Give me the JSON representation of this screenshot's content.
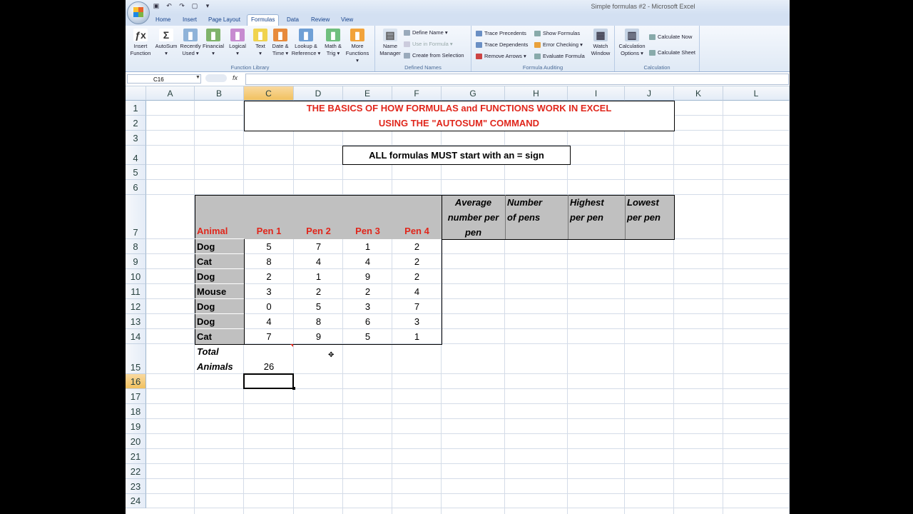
{
  "window": {
    "title": "Simple formulas #2 - Microsoft Excel"
  },
  "tabs": [
    "Home",
    "Insert",
    "Page Layout",
    "Formulas",
    "Data",
    "Review",
    "View"
  ],
  "active_tab": "Formulas",
  "ribbon": {
    "function_library": {
      "label": "Function Library",
      "buttons": [
        {
          "icon": "fx-icon",
          "label1": "Insert",
          "label2": "Function"
        },
        {
          "icon": "sigma-icon",
          "label1": "AutoSum",
          "label2": "▾"
        },
        {
          "icon": "book-icon",
          "label1": "Recently",
          "label2": "Used ▾"
        },
        {
          "icon": "book-icon",
          "label1": "Financial",
          "label2": "▾"
        },
        {
          "icon": "book-icon",
          "label1": "Logical",
          "label2": "▾"
        },
        {
          "icon": "book-icon",
          "label1": "Text",
          "label2": "▾"
        },
        {
          "icon": "book-icon",
          "label1": "Date &",
          "label2": "Time ▾"
        },
        {
          "icon": "book-icon",
          "label1": "Lookup &",
          "label2": "Reference ▾"
        },
        {
          "icon": "book-icon",
          "label1": "Math &",
          "label2": "Trig ▾"
        },
        {
          "icon": "book-icon",
          "label1": "More",
          "label2": "Functions ▾"
        }
      ]
    },
    "defined_names": {
      "label": "Defined Names",
      "name_manager": {
        "label1": "Name",
        "label2": "Manager"
      },
      "define_name": "Define Name ▾",
      "use_in_formula": "Use in Formula ▾",
      "create_from_selection": "Create from Selection"
    },
    "formula_auditing": {
      "label": "Formula Auditing",
      "trace_precedents": "Trace Precedents",
      "trace_dependents": "Trace Dependents",
      "remove_arrows": "Remove Arrows ▾",
      "show_formulas": "Show Formulas",
      "error_checking": "Error Checking ▾",
      "evaluate_formula": "Evaluate Formula",
      "watch_window": {
        "label1": "Watch",
        "label2": "Window"
      }
    },
    "calculation": {
      "label": "Calculation",
      "options": {
        "label1": "Calculation",
        "label2": "Options ▾"
      },
      "calculate_now": "Calculate Now",
      "calculate_sheet": "Calculate Sheet"
    }
  },
  "formula_bar": {
    "name_box": "C16",
    "fx": "fx",
    "formula": ""
  },
  "columns": [
    "A",
    "B",
    "C",
    "D",
    "E",
    "F",
    "G",
    "H",
    "I",
    "J",
    "K",
    "L"
  ],
  "selected_column": "C",
  "rows": [
    "1",
    "2",
    "3",
    "4",
    "5",
    "6",
    "7",
    "8",
    "9",
    "10",
    "11",
    "12",
    "13",
    "14",
    "15",
    "16",
    "17",
    "18",
    "19",
    "20",
    "21",
    "22",
    "23",
    "24"
  ],
  "selected_row": "16",
  "sheet": {
    "title1": "THE BASICS OF HOW FORMULAS and FUNCTIONS WORK IN EXCEL",
    "title2": "USING THE \"AUTOSUM\" COMMAND",
    "note": "ALL   formulas MUST start with an = sign",
    "headers": [
      "Animal",
      "Pen 1",
      "Pen 2",
      "Pen 3",
      "Pen 4"
    ],
    "stat_headers": [
      {
        "l1": "Average",
        "l2": "number per",
        "l3": "pen"
      },
      {
        "l1": "Number",
        "l2": "of pens",
        "l3": ""
      },
      {
        "l1": "Highest",
        "l2": "per pen",
        "l3": ""
      },
      {
        "l1": "Lowest",
        "l2": "per pen",
        "l3": ""
      }
    ],
    "data": [
      {
        "animal": "Dog",
        "v": [
          "5",
          "7",
          "1",
          "2"
        ]
      },
      {
        "animal": "Cat",
        "v": [
          "8",
          "4",
          "4",
          "2"
        ]
      },
      {
        "animal": "Dog",
        "v": [
          "2",
          "1",
          "9",
          "2"
        ]
      },
      {
        "animal": "Mouse",
        "v": [
          "3",
          "2",
          "2",
          "4"
        ]
      },
      {
        "animal": "Dog",
        "v": [
          "0",
          "5",
          "3",
          "7"
        ]
      },
      {
        "animal": "Dog",
        "v": [
          "4",
          "8",
          "6",
          "3"
        ]
      },
      {
        "animal": "Cat",
        "v": [
          "7",
          "9",
          "5",
          "1"
        ]
      }
    ],
    "total_label1": "Total",
    "total_label2": "Animals",
    "total_value": "26"
  }
}
